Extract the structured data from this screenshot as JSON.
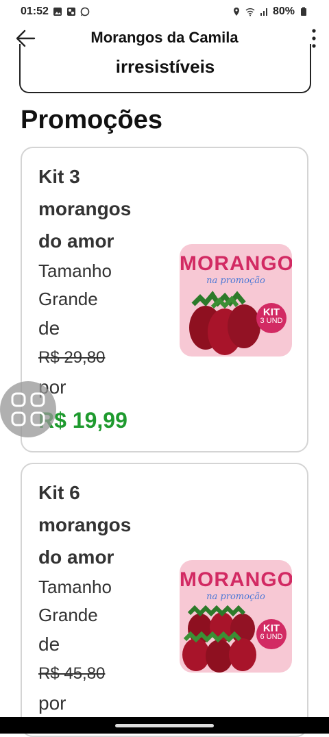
{
  "status": {
    "time": "01:52",
    "battery": "80%"
  },
  "header": {
    "title": "Morangos da Camila"
  },
  "previous_card": {
    "text": "irresistíveis"
  },
  "section": {
    "title": "Promoções"
  },
  "products": [
    {
      "name_line1": "Kit 3",
      "name_line2": "morangos",
      "name_line3": "do amor",
      "size_line1": "Tamanho",
      "size_line2": "Grande",
      "from_label": "de",
      "old_price": "R$ 29,80",
      "to_label": "por",
      "new_price": "R$ 19,99",
      "image": {
        "title": "MORANGOS",
        "subtitle": "na promoção",
        "badge_top": "KIT",
        "badge_bottom": "3 UND"
      }
    },
    {
      "name_line1": "Kit 6",
      "name_line2": "morangos",
      "name_line3": "do amor",
      "size_line1": "Tamanho",
      "size_line2": "Grande",
      "from_label": "de",
      "old_price": "R$ 45,80",
      "to_label": "por",
      "image": {
        "title": "MORANGOS",
        "subtitle": "na promoção",
        "badge_top": "KIT",
        "badge_bottom": "6 UND"
      }
    }
  ],
  "colors": {
    "price_green": "#1e9a2e",
    "brand_pink": "#d22a63",
    "card_border": "#d4d4d4"
  }
}
